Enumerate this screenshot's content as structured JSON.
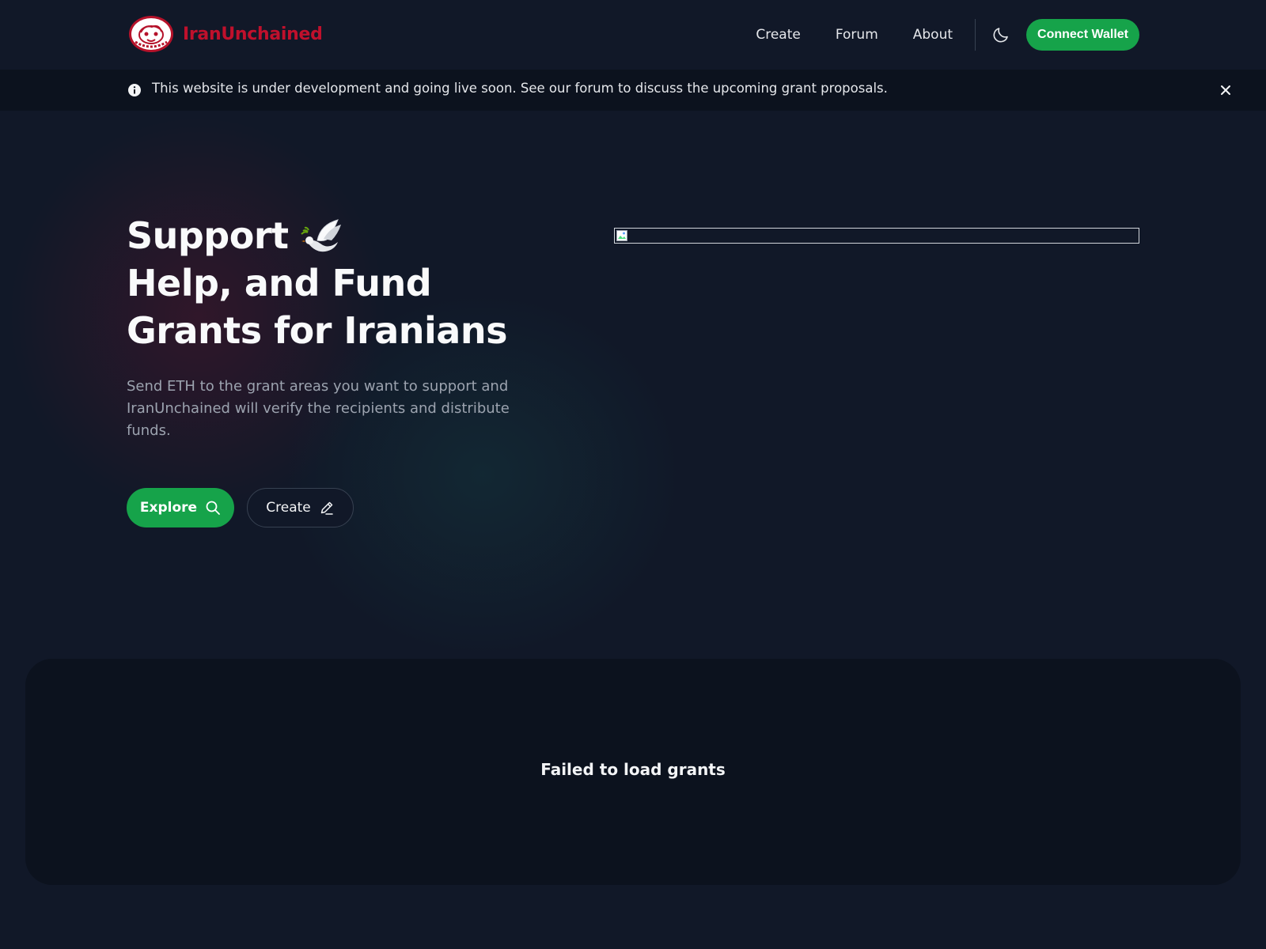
{
  "brand": {
    "name": "IranUnchained"
  },
  "nav": {
    "links": [
      "Create",
      "Forum",
      "About"
    ],
    "connect_label": "Connect Wallet"
  },
  "banner": {
    "text": "This website is under development and going live soon. See our forum to discuss the upcoming grant proposals."
  },
  "hero": {
    "title_line1": "Support",
    "title_line2": "Help, and Fund",
    "title_line3": "Grants for Iranians",
    "subtitle": "Send ETH to the grant areas you want to support and IranUnchained will verify the recipients and distribute funds.",
    "explore_label": "Explore",
    "create_label": "Create"
  },
  "grants": {
    "error": "Failed to load grants"
  },
  "colors": {
    "accent": "#16a34a",
    "brand": "#c0102c",
    "background": "#111828",
    "panel": "#0c121e"
  },
  "icons": {
    "banner": "info-icon",
    "theme": "moon-icon",
    "close": "close-icon",
    "explore": "search-icon",
    "create": "pencil-icon",
    "dove": "dove-icon"
  }
}
